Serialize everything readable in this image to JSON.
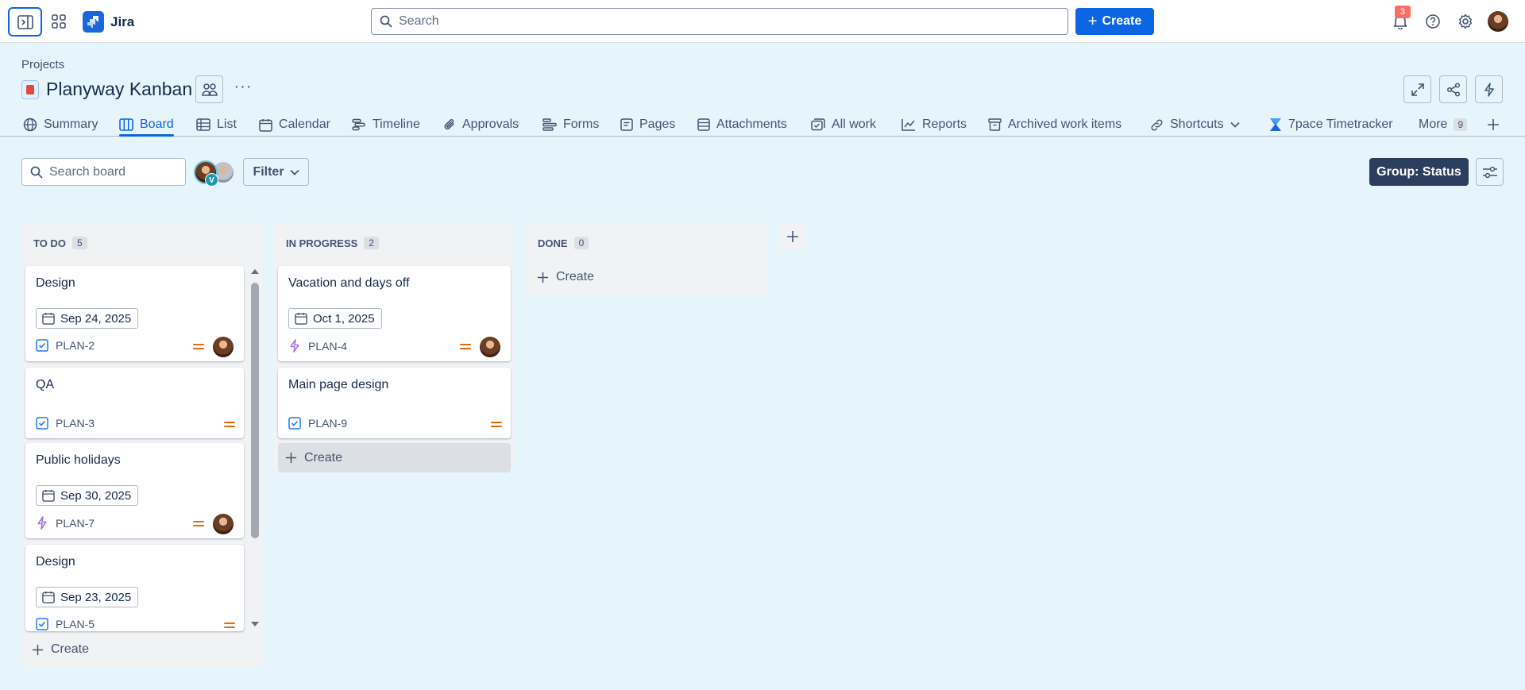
{
  "app": {
    "name": "Jira"
  },
  "topbar": {
    "search_placeholder": "Search",
    "create_label": "Create",
    "notification_count": "3"
  },
  "project": {
    "breadcrumb": "Projects",
    "title": "Planyway Kanban",
    "more": "···"
  },
  "tabs": [
    {
      "label": "Summary"
    },
    {
      "label": "Board"
    },
    {
      "label": "List"
    },
    {
      "label": "Calendar"
    },
    {
      "label": "Timeline"
    },
    {
      "label": "Approvals"
    },
    {
      "label": "Forms"
    },
    {
      "label": "Pages"
    },
    {
      "label": "Attachments"
    },
    {
      "label": "All work"
    },
    {
      "label": "Reports"
    },
    {
      "label": "Archived work items"
    },
    {
      "label": "Shortcuts"
    },
    {
      "label": "7pace Timetracker"
    },
    {
      "label": "More",
      "count": "9"
    }
  ],
  "active_tab": "Board",
  "toolbar": {
    "search_placeholder": "Search board",
    "avatar_badge": "V",
    "filter_label": "Filter",
    "group_label": "Group: Status"
  },
  "columns": [
    {
      "title": "TO DO",
      "count": "5",
      "create_label": "Create",
      "cards": [
        {
          "title": "Design",
          "date": "Sep 24, 2025",
          "key": "PLAN-2",
          "type": "task",
          "priority": "medium",
          "assignee": true
        },
        {
          "title": "QA",
          "date": "",
          "key": "PLAN-3",
          "type": "task",
          "priority": "medium",
          "assignee": false
        },
        {
          "title": "Public holidays",
          "date": "Sep 30, 2025",
          "key": "PLAN-7",
          "type": "epic",
          "priority": "medium",
          "assignee": true
        },
        {
          "title": "Design",
          "date": "Sep 23, 2025",
          "key": "PLAN-5",
          "type": "task",
          "priority": "medium",
          "assignee": false
        }
      ]
    },
    {
      "title": "IN PROGRESS",
      "count": "2",
      "create_label": "Create",
      "cards": [
        {
          "title": "Vacation and days off",
          "date": "Oct 1, 2025",
          "key": "PLAN-4",
          "type": "epic",
          "priority": "medium",
          "assignee": true
        },
        {
          "title": "Main page design",
          "date": "",
          "key": "PLAN-9",
          "type": "task",
          "priority": "medium",
          "assignee": false
        }
      ]
    },
    {
      "title": "DONE",
      "count": "0",
      "create_label": "Create",
      "cards": []
    }
  ],
  "colors": {
    "accent": "#0c66e4",
    "priority": "#e56910",
    "epic": "#a06ee2",
    "background": "#e6f4fb"
  }
}
